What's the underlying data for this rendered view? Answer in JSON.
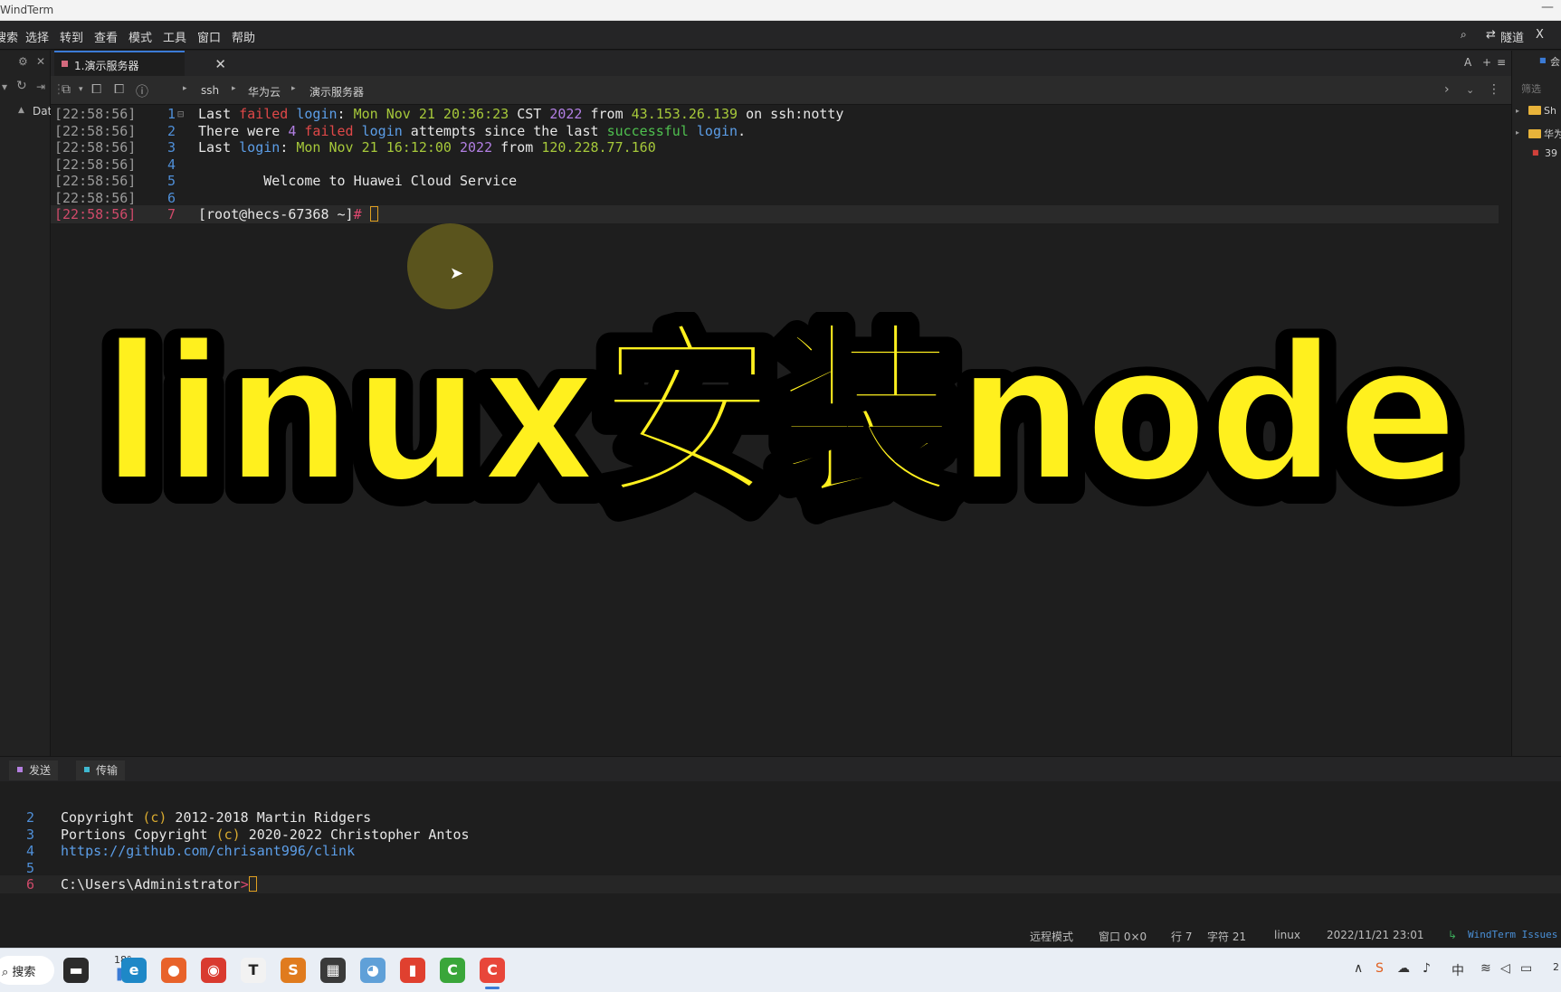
{
  "window": {
    "title": "WindTerm",
    "minimize_glyph": "—"
  },
  "menu": [
    "搜索",
    "选择",
    "转到",
    "查看",
    "模式",
    "工具",
    "窗口",
    "帮助"
  ],
  "menu_right": {
    "search_icon": "search-icon",
    "tunnel": "隧道",
    "close_glyph": "X"
  },
  "left_strip": {
    "date_label": "Dat"
  },
  "tab": {
    "label": "1.演示服务器",
    "close_glyph": "✕"
  },
  "tab_right": {
    "font_btn": "A",
    "add_btn": "+",
    "menu_btn": "≡"
  },
  "breadcrumb": [
    "ssh",
    "华为云",
    "演示服务器"
  ],
  "terminal": {
    "timestamp": "[22:58:56]",
    "lines": [
      {
        "n": "1",
        "segments": [
          [
            "w",
            "Last "
          ],
          [
            "r",
            "failed "
          ],
          [
            "b",
            "login"
          ],
          [
            "w",
            ": "
          ],
          [
            "g",
            "Mon Nov 21 20:36:23 "
          ],
          [
            "w",
            "CST "
          ],
          [
            "p",
            "2022"
          ],
          [
            "w",
            " from "
          ],
          [
            "g",
            "43.153.26.139"
          ],
          [
            "w",
            " on ssh:notty"
          ]
        ]
      },
      {
        "n": "2",
        "segments": [
          [
            "w",
            "There were "
          ],
          [
            "p",
            "4 "
          ],
          [
            "r",
            "failed "
          ],
          [
            "b",
            "login"
          ],
          [
            "w",
            " attempts since the last "
          ],
          [
            "gr",
            "successful "
          ],
          [
            "b",
            "login"
          ],
          [
            "w",
            "."
          ]
        ]
      },
      {
        "n": "3",
        "segments": [
          [
            "w",
            "Last "
          ],
          [
            "b",
            "login"
          ],
          [
            "w",
            ": "
          ],
          [
            "g",
            "Mon Nov 21 16:12:00 "
          ],
          [
            "p",
            "2022"
          ],
          [
            "w",
            " from "
          ],
          [
            "g",
            "120.228.77.160"
          ]
        ]
      },
      {
        "n": "4",
        "segments": []
      },
      {
        "n": "5",
        "segments": [
          [
            "w",
            "        Welcome to Huawei Cloud Service"
          ]
        ]
      },
      {
        "n": "6",
        "segments": []
      },
      {
        "n": "7",
        "segments": [
          [
            "w",
            "[root@hecs-67368 ~]"
          ],
          [
            "pk",
            "# "
          ]
        ]
      }
    ]
  },
  "overlay_title": "linux安装node",
  "right_panel": {
    "filter": "筛选",
    "items": [
      "Sh",
      "华为",
      "39"
    ],
    "top_label": "会"
  },
  "bottom_tabs": [
    "发送",
    "传输"
  ],
  "shell": {
    "lines": [
      {
        "n": "2",
        "segments": [
          [
            "w",
            "Copyright "
          ],
          [
            "yel",
            "(c)"
          ],
          [
            "w",
            " 2012-2018 Martin Ridgers"
          ]
        ]
      },
      {
        "n": "3",
        "segments": [
          [
            "w",
            "Portions Copyright "
          ],
          [
            "yel",
            "(c)"
          ],
          [
            "w",
            " 2020-2022 Christopher Antos"
          ]
        ]
      },
      {
        "n": "4",
        "segments": [
          [
            "lnk",
            "https://github.com/chrisant996/clink"
          ]
        ]
      },
      {
        "n": "5",
        "segments": []
      },
      {
        "n": "6",
        "segments": [
          [
            "w",
            "C:\\Users\\Administrator"
          ],
          [
            "pk",
            ">"
          ]
        ]
      }
    ]
  },
  "status": {
    "mode": "远程模式",
    "window": "窗口 0×0",
    "row": "行 7",
    "col": "字符 21",
    "os": "linux",
    "datetime": "2022/11/21 23:01",
    "issues": "WindTerm Issues"
  },
  "taskbar": {
    "search_label": "搜索",
    "weather": "18°",
    "apps": [
      {
        "name": "file-explorer",
        "glyph": "▬",
        "color": "#2b2b2b"
      },
      {
        "name": "edge",
        "glyph": "e",
        "color": "#1e88c7"
      },
      {
        "name": "firefox",
        "glyph": "●",
        "color": "#e8622a"
      },
      {
        "name": "chrome",
        "glyph": "◉",
        "color": "#d93a2f"
      },
      {
        "name": "typora",
        "glyph": "T",
        "color": "#f2f2f2"
      },
      {
        "name": "sublime",
        "glyph": "S",
        "color": "#e07b1e"
      },
      {
        "name": "terminal",
        "glyph": "▦",
        "color": "#3a3a3a"
      },
      {
        "name": "game",
        "glyph": "◕",
        "color": "#5fa0d8"
      },
      {
        "name": "wps",
        "glyph": "▮",
        "color": "#e0402f"
      },
      {
        "name": "cmd-green",
        "glyph": "C",
        "color": "#3aa63a"
      },
      {
        "name": "windterm",
        "glyph": "C",
        "color": "#e8463a"
      }
    ],
    "tray_time": "2"
  }
}
